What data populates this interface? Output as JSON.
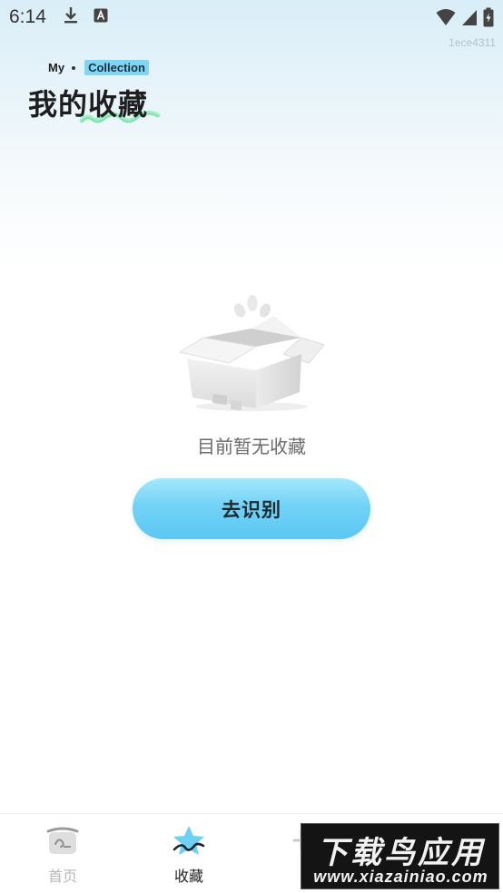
{
  "status_bar": {
    "time": "6:14",
    "icons": [
      "download-icon",
      "keyboard-a-icon",
      "wifi-icon",
      "signal-icon",
      "battery-charging-icon"
    ]
  },
  "build_id": "1ece4311",
  "header": {
    "prefix": "My",
    "tag": "Collection",
    "title": "我的收藏"
  },
  "empty_state": {
    "icon": "empty-box-icon",
    "message": "目前暂无收藏",
    "action_label": "去识别"
  },
  "bottom_nav": {
    "items": [
      {
        "label": "首页",
        "icon": "home-icon",
        "active": false
      },
      {
        "label": "收藏",
        "icon": "star-icon",
        "active": true
      }
    ]
  },
  "watermark": {
    "title": "下载鸟应用",
    "url": "www.xiazainiao.com"
  },
  "colors": {
    "accent": "#6fd0f5",
    "tag_bg": "#7fd6f4",
    "inactive_nav": "#b8b8b8",
    "underline": "#7fe3a8"
  }
}
